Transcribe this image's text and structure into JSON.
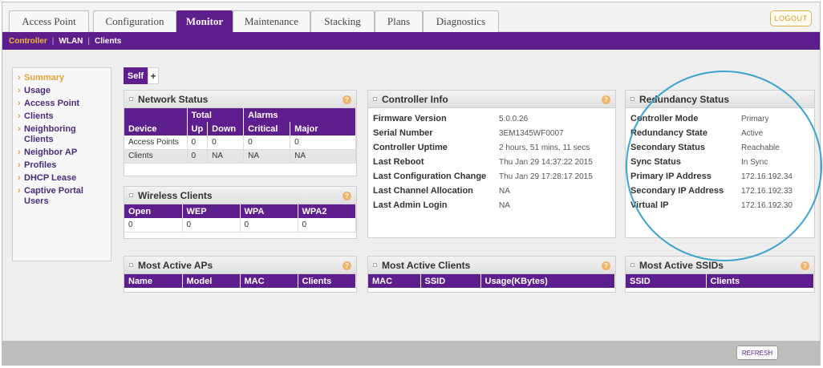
{
  "tabs": [
    {
      "label": "Access Point",
      "active": false
    },
    {
      "label": "Configuration",
      "active": false
    },
    {
      "label": "Monitor",
      "active": true
    },
    {
      "label": "Maintenance",
      "active": false
    },
    {
      "label": "Stacking",
      "active": false
    },
    {
      "label": "Plans",
      "active": false
    },
    {
      "label": "Diagnostics",
      "active": false
    }
  ],
  "logout_label": "LOGOUT",
  "subnav": {
    "controller": "Controller",
    "wlan": "WLAN",
    "clients": "Clients"
  },
  "sidebar": {
    "items": [
      {
        "label": "Summary",
        "selected": true
      },
      {
        "label": "Usage"
      },
      {
        "label": "Access Point"
      },
      {
        "label": "Clients"
      },
      {
        "label": "Neighboring Clients"
      },
      {
        "label": "Neighbor AP"
      },
      {
        "label": "Profiles"
      },
      {
        "label": "DHCP Lease"
      },
      {
        "label": "Captive Portal Users"
      }
    ]
  },
  "self_label": "Self",
  "plus_label": "+",
  "network_status": {
    "title": "Network Status",
    "group_headers": [
      "",
      "Total",
      "Alarms"
    ],
    "columns": [
      "Device",
      "Up",
      "Down",
      "Critical",
      "Major"
    ],
    "rows": [
      [
        "Access Points",
        "0",
        "0",
        "0",
        "0"
      ],
      [
        "Clients",
        "0",
        "NA",
        "NA",
        "NA"
      ]
    ]
  },
  "wireless_clients": {
    "title": "Wireless Clients",
    "columns": [
      "Open",
      "WEP",
      "WPA",
      "WPA2"
    ],
    "rows": [
      [
        "0",
        "0",
        "0",
        "0"
      ]
    ]
  },
  "controller_info": {
    "title": "Controller Info",
    "rows": [
      {
        "k": "Firmware Version",
        "v": "5.0.0.26"
      },
      {
        "k": "Serial Number",
        "v": "3EM1345WF0007"
      },
      {
        "k": "Controller Uptime",
        "v": "2 hours, 51 mins, 11 secs"
      },
      {
        "k": "Last Reboot",
        "v": "Thu Jan 29 14:37:22 2015"
      },
      {
        "k": "Last Configuration Change",
        "v": "Thu Jan 29 17:28:17 2015"
      },
      {
        "k": "Last Channel Allocation",
        "v": "NA"
      },
      {
        "k": "Last Admin Login",
        "v": "NA"
      }
    ]
  },
  "redundancy_status": {
    "title": "Redundancy Status",
    "rows": [
      {
        "k": "Controller Mode",
        "v": "Primary"
      },
      {
        "k": "Redundancy State",
        "v": "Active"
      },
      {
        "k": "Secondary Status",
        "v": "Reachable"
      },
      {
        "k": "Sync Status",
        "v": "In Sync"
      },
      {
        "k": "Primary IP Address",
        "v": "172.16.192.34"
      },
      {
        "k": "Secondary IP Address",
        "v": "172.16.192.33"
      },
      {
        "k": "Virtual IP",
        "v": "172.16.192.30"
      }
    ]
  },
  "most_active_aps": {
    "title": "Most Active APs",
    "columns": [
      "Name",
      "Model",
      "MAC",
      "Clients"
    ]
  },
  "most_active_clients": {
    "title": "Most Active Clients",
    "columns": [
      "MAC",
      "SSID",
      "Usage(KBytes)"
    ]
  },
  "most_active_ssids": {
    "title": "Most Active SSIDs",
    "columns": [
      "SSID",
      "Clients"
    ]
  },
  "help_glyph": "?",
  "refresh_label": "REFRESH"
}
